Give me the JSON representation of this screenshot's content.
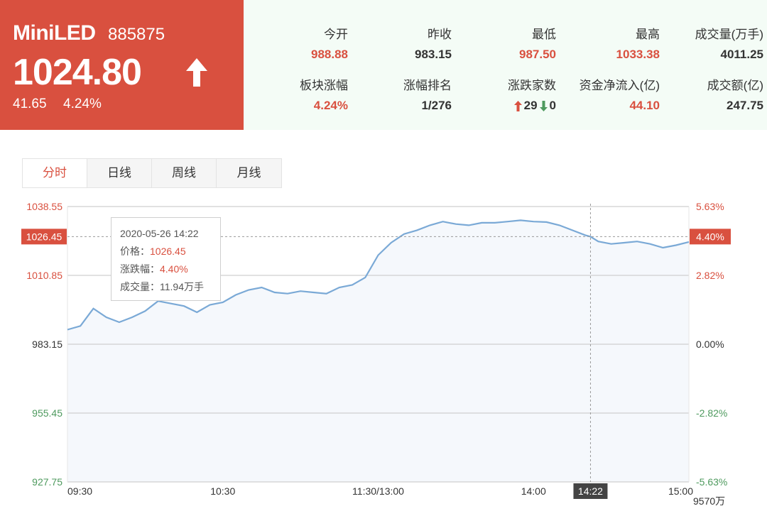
{
  "quote": {
    "name": "MiniLED",
    "code": "885875",
    "price": "1024.80",
    "change": "41.65",
    "change_pct": "4.24%",
    "direction_icon": "arrow-up-icon"
  },
  "stats": [
    {
      "label": "今开",
      "value": "988.88",
      "color": "red"
    },
    {
      "label": "昨收",
      "value": "983.15",
      "color": "dark"
    },
    {
      "label": "最低",
      "value": "987.50",
      "color": "red"
    },
    {
      "label": "最高",
      "value": "1033.38",
      "color": "red"
    },
    {
      "label": "成交量(万手)",
      "value": "4011.25",
      "color": "dark"
    },
    {
      "label": "板块涨幅",
      "value": "4.24%",
      "color": "red"
    },
    {
      "label": "涨幅排名",
      "value": "1/276",
      "color": "dark"
    },
    {
      "label": "涨跌家数",
      "up_count": "29",
      "down_count": "0"
    },
    {
      "label": "资金净流入(亿)",
      "value": "44.10",
      "color": "red"
    },
    {
      "label": "成交额(亿)",
      "value": "247.75",
      "color": "dark"
    }
  ],
  "tabs": [
    {
      "label": "分时",
      "active": true
    },
    {
      "label": "日线",
      "active": false
    },
    {
      "label": "周线",
      "active": false
    },
    {
      "label": "月线",
      "active": false
    }
  ],
  "colors": {
    "up": "#d9503f",
    "down": "#4e9a5e",
    "line": "#7aa9d6",
    "fill": "#f5f8fc",
    "grid": "#cfcfcf"
  },
  "tooltip": {
    "datetime": "2020-05-26 14:22",
    "price_label": "价格：",
    "price": "1026.45",
    "change_label": "涨跌幅：",
    "change": "4.40%",
    "volume_label": "成交量：",
    "volume": "11.94万手"
  },
  "chart_data": {
    "type": "line",
    "prev_close": 983.15,
    "ylim": [
      927.75,
      1038.55
    ],
    "left_ticks": [
      "1038.55",
      "1010.85",
      "983.15",
      "955.45",
      "927.75"
    ],
    "right_ticks": [
      "5.63%",
      "2.82%",
      "0.00%",
      "-2.82%",
      "-5.63%"
    ],
    "x_ticks": [
      "09:30",
      "10:30",
      "11:30/13:00",
      "14:00",
      "15:00"
    ],
    "volume_unit": "9570万",
    "crosshair": {
      "time": "14:22",
      "price_label": "1026.45",
      "pct_label": "4.40%"
    },
    "x": [
      "09:30",
      "09:35",
      "09:40",
      "09:45",
      "09:50",
      "09:55",
      "10:00",
      "10:05",
      "10:10",
      "10:15",
      "10:20",
      "10:25",
      "10:30",
      "10:35",
      "10:40",
      "10:45",
      "10:50",
      "10:55",
      "11:00",
      "11:05",
      "11:10",
      "11:15",
      "11:20",
      "11:25",
      "11:30",
      "13:05",
      "13:10",
      "13:15",
      "13:20",
      "13:25",
      "13:30",
      "13:35",
      "13:40",
      "13:45",
      "13:50",
      "13:55",
      "14:00",
      "14:05",
      "14:10",
      "14:15",
      "14:20",
      "14:22",
      "14:25",
      "14:30",
      "14:35",
      "14:40",
      "14:45",
      "14:50",
      "14:55",
      "15:00"
    ],
    "values": [
      989.0,
      990.5,
      997.5,
      994.0,
      992.0,
      994.0,
      996.5,
      1000.5,
      999.5,
      998.5,
      996.0,
      999.0,
      1000.0,
      1003.0,
      1005.0,
      1006.0,
      1004.0,
      1003.5,
      1004.5,
      1004.0,
      1003.5,
      1006.0,
      1007.0,
      1010.0,
      1019.0,
      1024.0,
      1027.5,
      1029.0,
      1031.0,
      1032.5,
      1031.5,
      1031.0,
      1032.0,
      1032.0,
      1032.5,
      1033.0,
      1032.5,
      1032.3,
      1031.0,
      1029.0,
      1027.0,
      1026.45,
      1024.5,
      1023.5,
      1024.0,
      1024.5,
      1023.5,
      1022.0,
      1023.0,
      1024.3
    ]
  }
}
